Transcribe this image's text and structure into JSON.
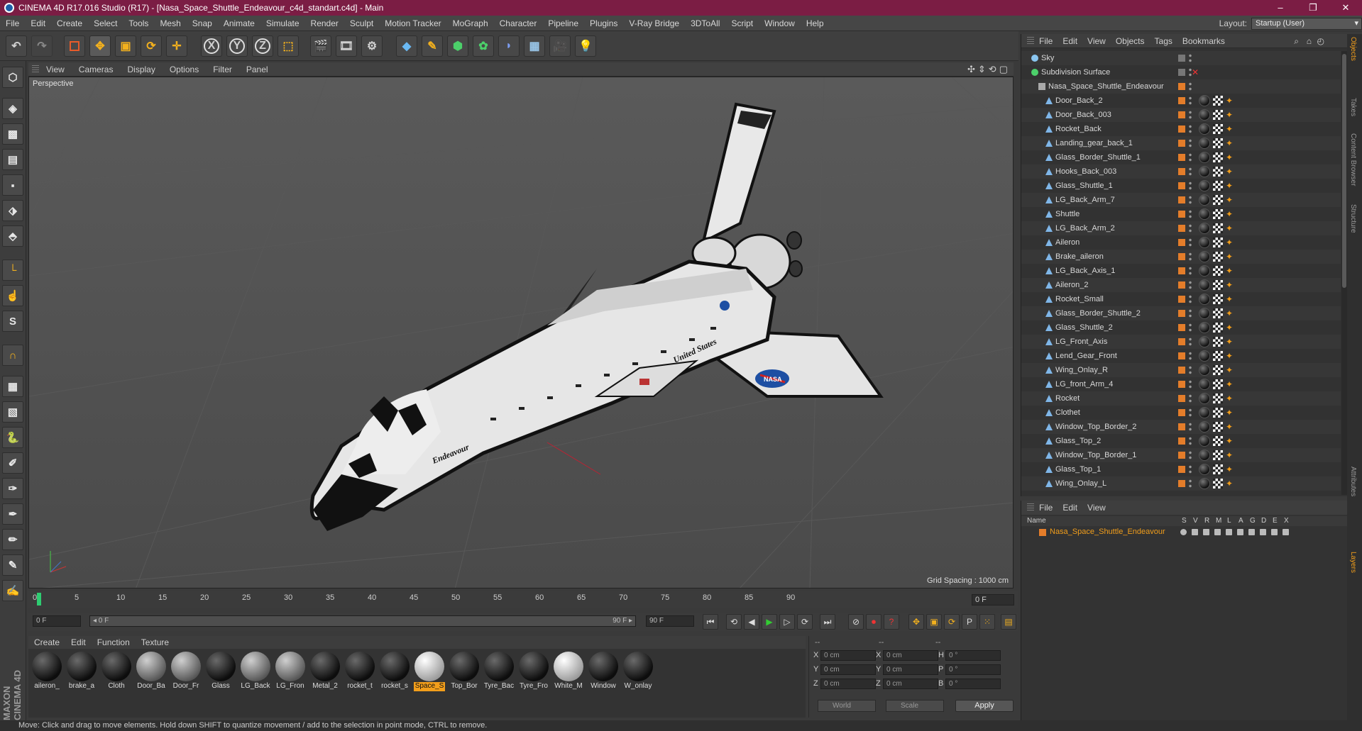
{
  "window": {
    "title": "CINEMA 4D R17.016 Studio (R17) - [Nasa_Space_Shuttle_Endeavour_c4d_standart.c4d] - Main",
    "minimize": "–",
    "restore": "❐",
    "close": "✕"
  },
  "menubar": {
    "items": [
      "File",
      "Edit",
      "Create",
      "Select",
      "Tools",
      "Mesh",
      "Snap",
      "Animate",
      "Simulate",
      "Render",
      "Sculpt",
      "Motion Tracker",
      "MoGraph",
      "Character",
      "Pipeline",
      "Plugins",
      "V-Ray Bridge",
      "3DToAll",
      "Script",
      "Window",
      "Help"
    ],
    "layout_label": "Layout:",
    "layout_value": "Startup (User)"
  },
  "toolbar": {
    "axis_x": "X",
    "axis_y": "Y",
    "axis_z": "Z"
  },
  "viewport": {
    "menu": [
      "View",
      "Cameras",
      "Display",
      "Options",
      "Filter",
      "Panel"
    ],
    "camera": "Perspective",
    "grid_spacing": "Grid Spacing : 1000 cm",
    "model_labels": {
      "name": "Endeavour",
      "country": "United States",
      "agency": "NASA"
    }
  },
  "timeline": {
    "ticks": [
      "0",
      "5",
      "10",
      "15",
      "20",
      "25",
      "30",
      "35",
      "40",
      "45",
      "50",
      "55",
      "60",
      "65",
      "70",
      "75",
      "80",
      "85",
      "90"
    ],
    "current_frame": "0 F"
  },
  "playback": {
    "start_field": "0 F",
    "range_start": "◂ 0 F",
    "range_end": "90 F ▸",
    "end_field": "90 F"
  },
  "materials": {
    "menu": [
      "Create",
      "Edit",
      "Function",
      "Texture"
    ],
    "items": [
      {
        "label": "aileron_",
        "style": "dark"
      },
      {
        "label": "brake_a",
        "style": "dark"
      },
      {
        "label": "Cloth",
        "style": "dark"
      },
      {
        "label": "Door_Ba",
        "style": "gray"
      },
      {
        "label": "Door_Fr",
        "style": "gray"
      },
      {
        "label": "Glass",
        "style": "dark"
      },
      {
        "label": "LG_Back",
        "style": "gray"
      },
      {
        "label": "LG_Fron",
        "style": "gray"
      },
      {
        "label": "Metal_2",
        "style": "dark"
      },
      {
        "label": "rocket_t",
        "style": "dark"
      },
      {
        "label": "rocket_s",
        "style": "dark"
      },
      {
        "label": "Space_S",
        "style": "white",
        "selected": true
      },
      {
        "label": "Top_Bor",
        "style": "dark"
      },
      {
        "label": "Tyre_Bac",
        "style": "dark"
      },
      {
        "label": "Tyre_Fro",
        "style": "dark"
      },
      {
        "label": "White_M",
        "style": "white"
      },
      {
        "label": "Window",
        "style": "dark"
      },
      {
        "label": "W_onlay",
        "style": "dark"
      }
    ]
  },
  "coords": {
    "h1": "--",
    "h2": "--",
    "h3": "--",
    "rows": [
      {
        "a": "X",
        "av": "0 cm",
        "b": "X",
        "bv": "0 cm",
        "c": "H",
        "cv": "0 °"
      },
      {
        "a": "Y",
        "av": "0 cm",
        "b": "Y",
        "bv": "0 cm",
        "c": "P",
        "cv": "0 °"
      },
      {
        "a": "Z",
        "av": "0 cm",
        "b": "Z",
        "bv": "0 cm",
        "c": "B",
        "cv": "0 °"
      }
    ],
    "space": "World",
    "mode": "Scale",
    "apply": "Apply"
  },
  "status": "Move: Click and drag to move elements. Hold down SHIFT to quantize movement / add to the selection in point mode, CTRL to remove.",
  "objects": {
    "menu": [
      "File",
      "Edit",
      "View",
      "Objects",
      "Tags",
      "Bookmarks"
    ],
    "items": [
      {
        "name": "Sky",
        "level": 0
      },
      {
        "name": "Subdivision Surface",
        "level": 0
      },
      {
        "name": "Nasa_Space_Shuttle_Endeavour",
        "level": 1
      },
      {
        "name": "Door_Back_2",
        "level": 2
      },
      {
        "name": "Door_Back_003",
        "level": 2
      },
      {
        "name": "Rocket_Back",
        "level": 2
      },
      {
        "name": "Landing_gear_back_1",
        "level": 2
      },
      {
        "name": "Glass_Border_Shuttle_1",
        "level": 2
      },
      {
        "name": "Hooks_Back_003",
        "level": 2
      },
      {
        "name": "Glass_Shuttle_1",
        "level": 2
      },
      {
        "name": "LG_Back_Arm_7",
        "level": 2
      },
      {
        "name": "Shuttle",
        "level": 2
      },
      {
        "name": "LG_Back_Arm_2",
        "level": 2
      },
      {
        "name": "Aileron",
        "level": 2
      },
      {
        "name": "Brake_aileron",
        "level": 2
      },
      {
        "name": "LG_Back_Axis_1",
        "level": 2
      },
      {
        "name": "Aileron_2",
        "level": 2
      },
      {
        "name": "Rocket_Small",
        "level": 2
      },
      {
        "name": "Glass_Border_Shuttle_2",
        "level": 2
      },
      {
        "name": "Glass_Shuttle_2",
        "level": 2
      },
      {
        "name": "LG_Front_Axis",
        "level": 2
      },
      {
        "name": "Lend_Gear_Front",
        "level": 2
      },
      {
        "name": "Wing_Onlay_R",
        "level": 2
      },
      {
        "name": "LG_front_Arm_4",
        "level": 2
      },
      {
        "name": "Rocket",
        "level": 2
      },
      {
        "name": "Clothet",
        "level": 2
      },
      {
        "name": "Window_Top_Border_2",
        "level": 2
      },
      {
        "name": "Glass_Top_2",
        "level": 2
      },
      {
        "name": "Window_Top_Border_1",
        "level": 2
      },
      {
        "name": "Glass_Top_1",
        "level": 2
      },
      {
        "name": "Wing_Onlay_L",
        "level": 2
      }
    ]
  },
  "layers": {
    "menu": [
      "File",
      "Edit",
      "View"
    ],
    "columns": [
      "Name",
      "S",
      "V",
      "R",
      "M",
      "L",
      "A",
      "G",
      "D",
      "E",
      "X"
    ],
    "row": "Nasa_Space_Shuttle_Endeavour"
  },
  "sidetabs": [
    "Objects",
    "Takes",
    "Content Browser",
    "Structure",
    "Attributes",
    "Layers"
  ],
  "brand": "MAXON CINEMA 4D",
  "colors": {
    "title_bar": "#7b1d44",
    "accent": "#f29e1b",
    "layer_color": "#e47d2a"
  }
}
